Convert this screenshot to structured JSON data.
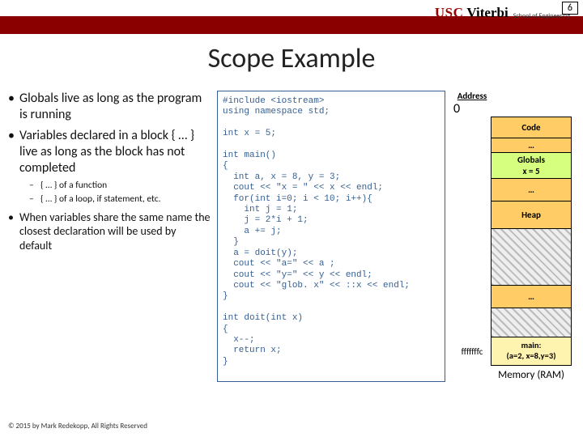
{
  "page_number": "6",
  "logo": {
    "usc": "USC",
    "viterbi": "Viterbi",
    "soe": "School of Engineering"
  },
  "title": "Scope Example",
  "bullets": {
    "b1": "Globals live as long as the program is running",
    "b2": "Variables declared in a block { … } live as long as the block has not completed",
    "b2s1": "{ … } of a function",
    "b2s2": "{ … } of a loop, if statement, etc.",
    "b3": "When variables share the same name the closest declaration will be used by default"
  },
  "code": "#include <iostream>\nusing namespace std;\n\nint x = 5;\n\nint main()\n{\n  int a, x = 8, y = 3;\n  cout << \"x = \" << x << endl;\n  for(int i=0; i < 10; i++){\n    int j = 1;\n    j = 2*i + 1;\n    a += j;\n  }\n  a = doit(y);\n  cout << \"a=\" << a ;\n  cout << \"y=\" << y << endl;\n  cout << \"glob. x\" << ::x << endl;\n}\n\nint doit(int x)\n{\n  x--;\n  return x;\n}",
  "mem": {
    "addr_label": "Address",
    "addr_start": "0",
    "addr_end": "fffffffc",
    "r_code": "Code",
    "r_dots": "…",
    "r_glob_l1": "Globals",
    "r_glob_l2": "x = 5",
    "r_heap": "Heap",
    "r_main_l1": "main:",
    "r_main_l2": "(a=2, x=8,y=3)",
    "caption": "Memory (RAM)"
  },
  "copyright": "© 2015 by Mark Redekopp, All Rights Reserved"
}
